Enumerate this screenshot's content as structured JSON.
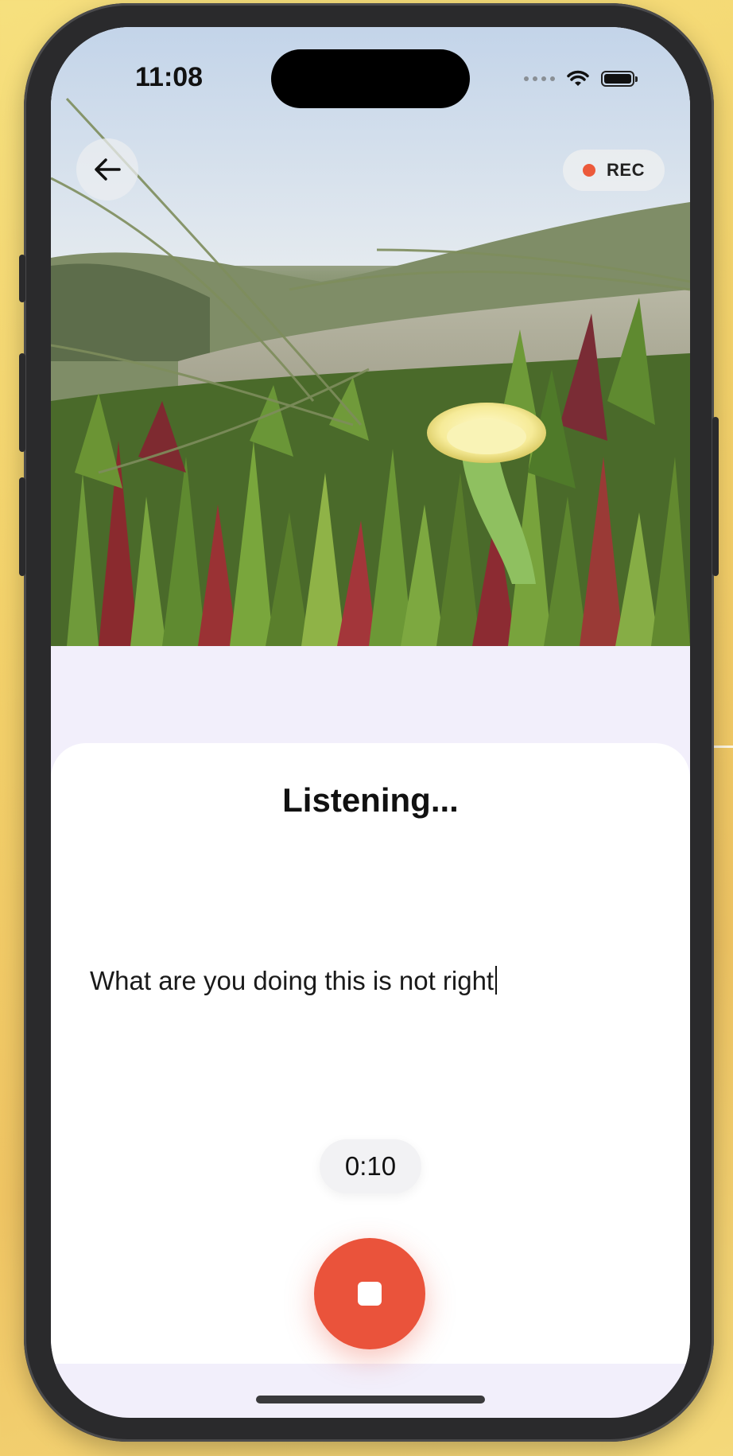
{
  "status_bar": {
    "time": "11:08"
  },
  "header": {
    "back_icon": "arrow-left-icon",
    "rec_label": "REC"
  },
  "sheet": {
    "title": "Listening...",
    "transcript": "What are you doing this is not right",
    "timer": "0:10",
    "stop_icon": "stop-icon"
  },
  "colors": {
    "accent": "#ea533b",
    "sheet_bg": "#ffffff",
    "page_bg": "#f2effb"
  }
}
